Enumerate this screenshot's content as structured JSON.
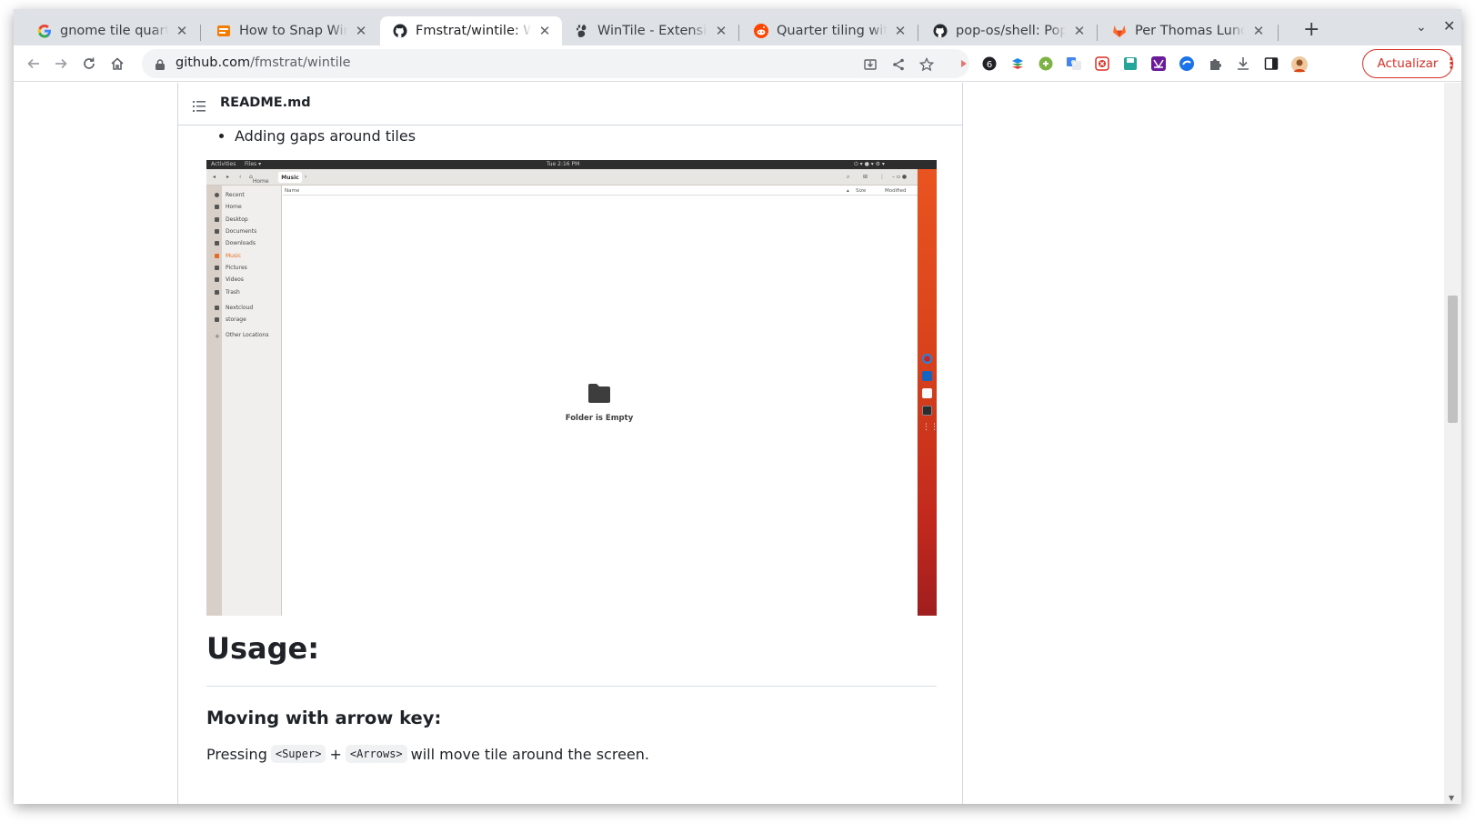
{
  "tabs": [
    {
      "title": "gnome tile quarterç",
      "favicon": "google-icon"
    },
    {
      "title": "How to Snap Windov",
      "favicon": "howto-icon"
    },
    {
      "title": "Fmstrat/wintile: Win",
      "favicon": "github-icon",
      "active": true
    },
    {
      "title": "WinTile - Extensione",
      "favicon": "gnome-icon"
    },
    {
      "title": "Quarter tiling withou",
      "favicon": "reddit-icon"
    },
    {
      "title": "pop-os/shell: Pop!_C",
      "favicon": "github-icon"
    },
    {
      "title": "Per Thomas Lundal /",
      "favicon": "gitlab-icon"
    }
  ],
  "toolbar": {
    "url_host": "github.com",
    "url_path": "/fmstrat/wintile",
    "update_label": "Actualizar"
  },
  "readme": {
    "file_name": "README.md",
    "bullet_text": "Adding gaps around tiles",
    "usage_heading": "Usage:",
    "moving_heading": "Moving with arrow key:",
    "para_prefix": "Pressing",
    "code_super": "<Super>",
    "plus": "+",
    "code_arrows": "<Arrows>",
    "para_suffix": "will move tile around the screen."
  },
  "screenshot": {
    "topbar_activities": "Activities",
    "topbar_app": "Files ▾",
    "topbar_clock": "Tue  2:16 PM",
    "crumb_home": "Home",
    "crumb_current": "Music",
    "sidebar": [
      "Recent",
      "Home",
      "Desktop",
      "Documents",
      "Downloads",
      "Music",
      "Pictures",
      "Videos",
      "Trash",
      "Nextcloud",
      "storage",
      "Other Locations"
    ],
    "col_name": "Name",
    "col_size": "Size",
    "col_modified": "Modified",
    "empty_text": "Folder is Empty"
  },
  "colors": {
    "accent_red": "#d93025",
    "ubuntu_orange": "#e95420",
    "music_highlight": "#e66b1e"
  }
}
